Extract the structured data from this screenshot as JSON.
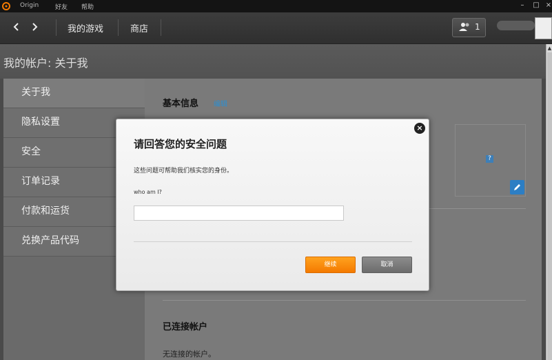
{
  "titlebar": {
    "menu": [
      "Origin",
      "好友",
      "帮助"
    ],
    "min_label": "–",
    "max_label": "□",
    "close_label": "×"
  },
  "nav": {
    "my_games": "我的游戏",
    "store": "商店",
    "friends_count": "1"
  },
  "page": {
    "title": "我的帐户: 关于我"
  },
  "sidebar": {
    "items": [
      {
        "label": "关于我"
      },
      {
        "label": "隐私设置"
      },
      {
        "label": "安全"
      },
      {
        "label": "订单记录"
      },
      {
        "label": "付款和运货"
      },
      {
        "label": "兑换产品代码"
      }
    ]
  },
  "content": {
    "basic_info": "基本信息",
    "edit": "编辑",
    "qmark": "?",
    "connected_accounts": "已连接帐户",
    "no_connected": "无连接的帐户。"
  },
  "modal": {
    "title": "请回答您的安全问题",
    "description": "这些问题可帮助我们核实您的身份。",
    "question": "who am I?",
    "answer_value": "",
    "continue": "继续",
    "cancel": "取消",
    "close": "×"
  },
  "colors": {
    "accent_orange": "#f47a00",
    "link_blue": "#2d8fd0"
  }
}
